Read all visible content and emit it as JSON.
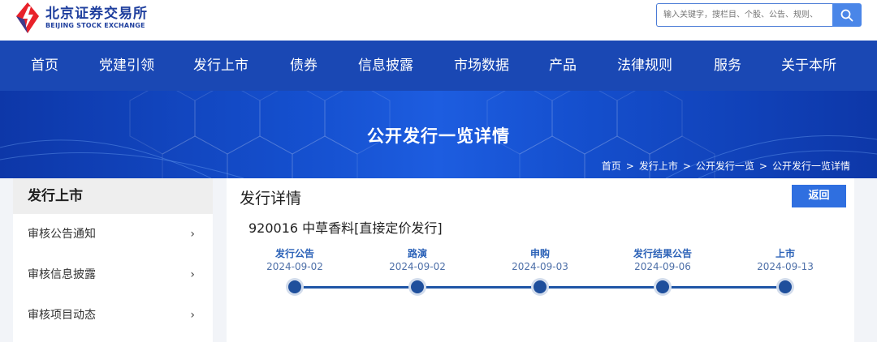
{
  "header": {
    "logo_cn": "北京证券交易所",
    "logo_en": "BEIJING STOCK EXCHANGE",
    "search_placeholder": "输入关键字，搜栏目、个股、公告、规则、",
    "colors": {
      "brand_blue": "#1a48b4",
      "logo_red": "#e8222a",
      "button_blue": "#4a86e8"
    }
  },
  "nav": {
    "items": [
      {
        "label": "首页"
      },
      {
        "label": "党建引领"
      },
      {
        "label": "发行上市"
      },
      {
        "label": "债券"
      },
      {
        "label": "信息披露"
      },
      {
        "label": "市场数据"
      },
      {
        "label": "产品"
      },
      {
        "label": "法律规则"
      },
      {
        "label": "服务"
      },
      {
        "label": "关于本所"
      }
    ]
  },
  "banner": {
    "title": "公开发行一览详情",
    "breadcrumb": [
      "首页",
      "发行上市",
      "公开发行一览",
      "公开发行一览详情"
    ],
    "separator": ">"
  },
  "sidebar": {
    "title": "发行上市",
    "items": [
      {
        "label": "审核公告通知"
      },
      {
        "label": "审核信息披露"
      },
      {
        "label": "审核项目动态"
      }
    ]
  },
  "main": {
    "title": "发行详情",
    "back_label": "返回",
    "stock_title": "920016 中草香料[直接定价发行]",
    "timeline": [
      {
        "name": "发行公告",
        "date": "2024-09-02"
      },
      {
        "name": "路演",
        "date": "2024-09-02"
      },
      {
        "name": "申购",
        "date": "2024-09-03"
      },
      {
        "name": "发行结果公告",
        "date": "2024-09-06"
      },
      {
        "name": "上市",
        "date": "2024-09-13"
      }
    ]
  }
}
